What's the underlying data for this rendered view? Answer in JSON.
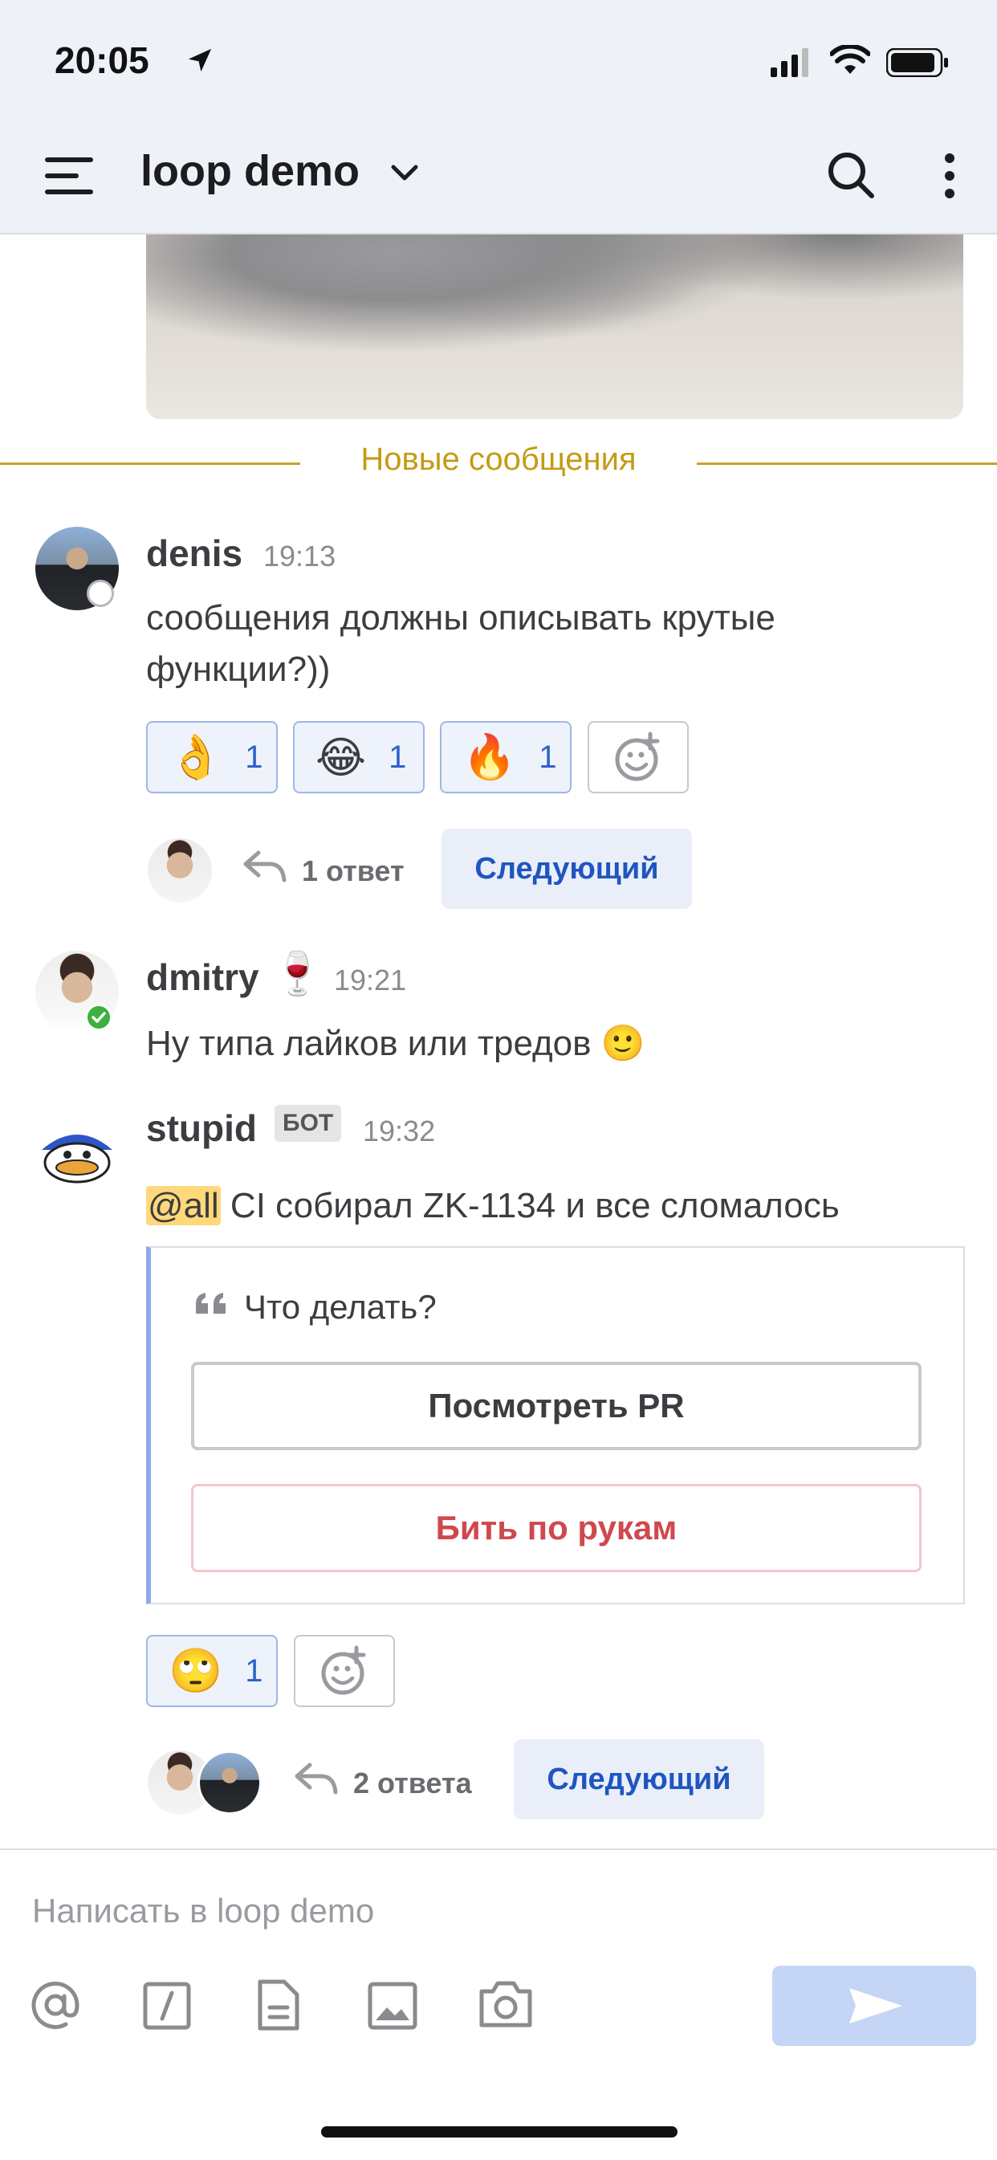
{
  "status_bar": {
    "time": "20:05"
  },
  "header": {
    "channel_name": "loop demo"
  },
  "divider": {
    "new_messages_label": "Новые сообщения"
  },
  "posts": [
    {
      "user": "denis",
      "time": "19:13",
      "text": "сообщения должны описывать крутые функции?))",
      "reactions": [
        {
          "emoji": "👌",
          "count": "1"
        },
        {
          "emoji": "😂",
          "count": "1"
        },
        {
          "emoji": "🔥",
          "count": "1"
        }
      ],
      "thread": {
        "replies": "1 ответ",
        "next_label": "Следующий"
      }
    },
    {
      "user": "dmitry",
      "user_emoji": "🍷",
      "time": "19:21",
      "text": "Ну типа лайков или тредов 🙂"
    },
    {
      "user": "stupid",
      "badge": "БОТ",
      "time": "19:32",
      "mention": "@all",
      "text": " CI собирал ZK-1134 и все сломалось",
      "attachment": {
        "title": "Что делать?",
        "buttons": [
          {
            "label": "Посмотреть PR",
            "color": "#3d3c40"
          },
          {
            "label": "Бить по рукам",
            "color": "#d0484f"
          }
        ]
      },
      "reactions": [
        {
          "emoji": "🙄",
          "count": "1"
        }
      ],
      "thread": {
        "replies": "2 ответа",
        "next_label": "Следующий"
      }
    }
  ],
  "composer": {
    "placeholder": "Написать в loop demo"
  },
  "colors": {
    "accent": "#1f55c0",
    "new_messages": "#c59b13",
    "online": "#3db03d"
  }
}
